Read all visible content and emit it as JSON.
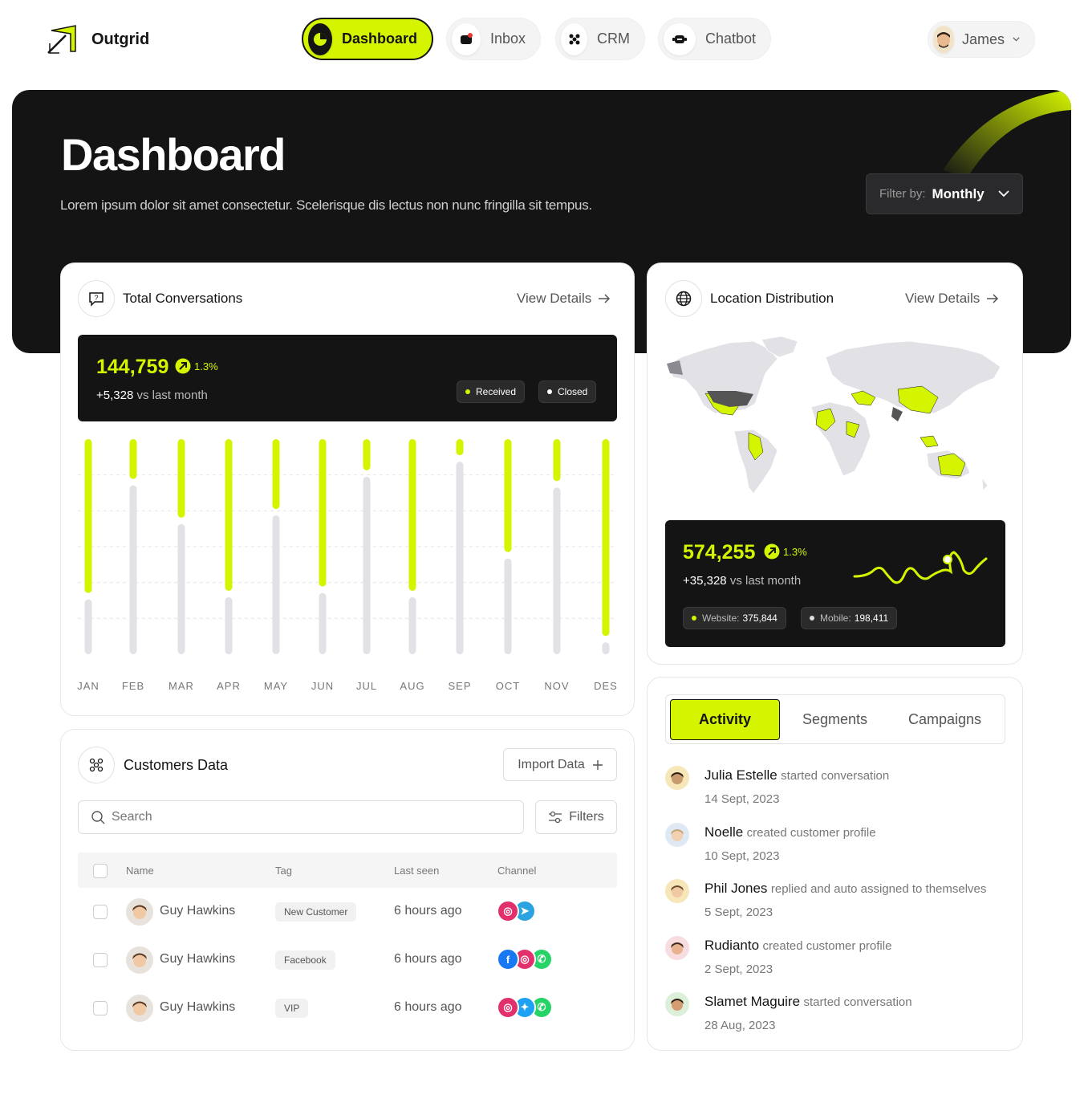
{
  "brand": {
    "name": "Outgrid"
  },
  "nav": {
    "dashboard": "Dashboard",
    "inbox": "Inbox",
    "crm": "CRM",
    "chatbot": "Chatbot",
    "user": "James"
  },
  "hero": {
    "title": "Dashboard",
    "subtitle": "Lorem ipsum dolor sit amet consectetur. Scelerisque dis lectus non nunc fringilla sit tempus.",
    "filter_label": "Filter by:",
    "filter_value": "Monthly"
  },
  "conversations": {
    "title": "Total Conversations",
    "view_details": "View Details",
    "total": "144,759",
    "change": "1.3%",
    "delta": "+5,328",
    "delta_suffix": "vs last month",
    "legend_received": "Received",
    "legend_closed": "Closed"
  },
  "chart_data": {
    "type": "bar",
    "categories": [
      "JAN",
      "FEB",
      "MAR",
      "APR",
      "MAY",
      "JUN",
      "JUL",
      "AUG",
      "SEP",
      "OCT",
      "NOV",
      "DES"
    ],
    "series": [
      {
        "name": "Received",
        "values": [
          73,
          20,
          38,
          72,
          34,
          70,
          16,
          72,
          9,
          54,
          21,
          93
        ]
      },
      {
        "name": "Closed",
        "values": [
          27,
          80,
          62,
          28,
          66,
          30,
          84,
          28,
          91,
          46,
          79,
          7
        ]
      }
    ],
    "ylim": [
      0,
      100
    ],
    "grid": true
  },
  "location": {
    "title": "Location Distribution",
    "view_details": "View Details",
    "total": "574,255",
    "change": "1.3%",
    "delta": "+35,328",
    "delta_suffix": "vs last month",
    "website_label": "Website:",
    "website_value": "375,844",
    "mobile_label": "Mobile:",
    "mobile_value": "198,411"
  },
  "customers": {
    "title": "Customers Data",
    "import": "Import Data",
    "search_placeholder": "Search",
    "filters": "Filters",
    "columns": {
      "name": "Name",
      "tag": "Tag",
      "last_seen": "Last seen",
      "channel": "Channel"
    },
    "rows": [
      {
        "name": "Guy Hawkins",
        "tag": "New Customer",
        "last_seen": "6 hours ago",
        "channels": [
          "instagram",
          "telegram"
        ]
      },
      {
        "name": "Guy Hawkins",
        "tag": "Facebook",
        "last_seen": "6 hours ago",
        "channels": [
          "facebook",
          "instagram",
          "whatsapp"
        ]
      },
      {
        "name": "Guy Hawkins",
        "tag": "VIP",
        "last_seen": "6 hours ago",
        "channels": [
          "instagram",
          "twitter",
          "whatsapp"
        ]
      }
    ]
  },
  "activity": {
    "tabs": [
      "Activity",
      "Segments",
      "Campaigns"
    ],
    "items": [
      {
        "name": "Julia Estelle",
        "action": "started conversation",
        "date": "14 Sept, 2023"
      },
      {
        "name": "Noelle",
        "action": "created customer profile",
        "date": "10 Sept, 2023"
      },
      {
        "name": "Phil Jones",
        "action": "replied and auto assigned to themselves",
        "date": "5 Sept, 2023"
      },
      {
        "name": "Rudianto",
        "action": "created customer profile",
        "date": "2 Sept, 2023"
      },
      {
        "name": "Slamet Maguire",
        "action": "started conversation",
        "date": "28 Aug, 2023"
      }
    ]
  },
  "colors": {
    "accent": "#d4f400",
    "dark": "#141414",
    "closed": "#e2e2e6"
  }
}
